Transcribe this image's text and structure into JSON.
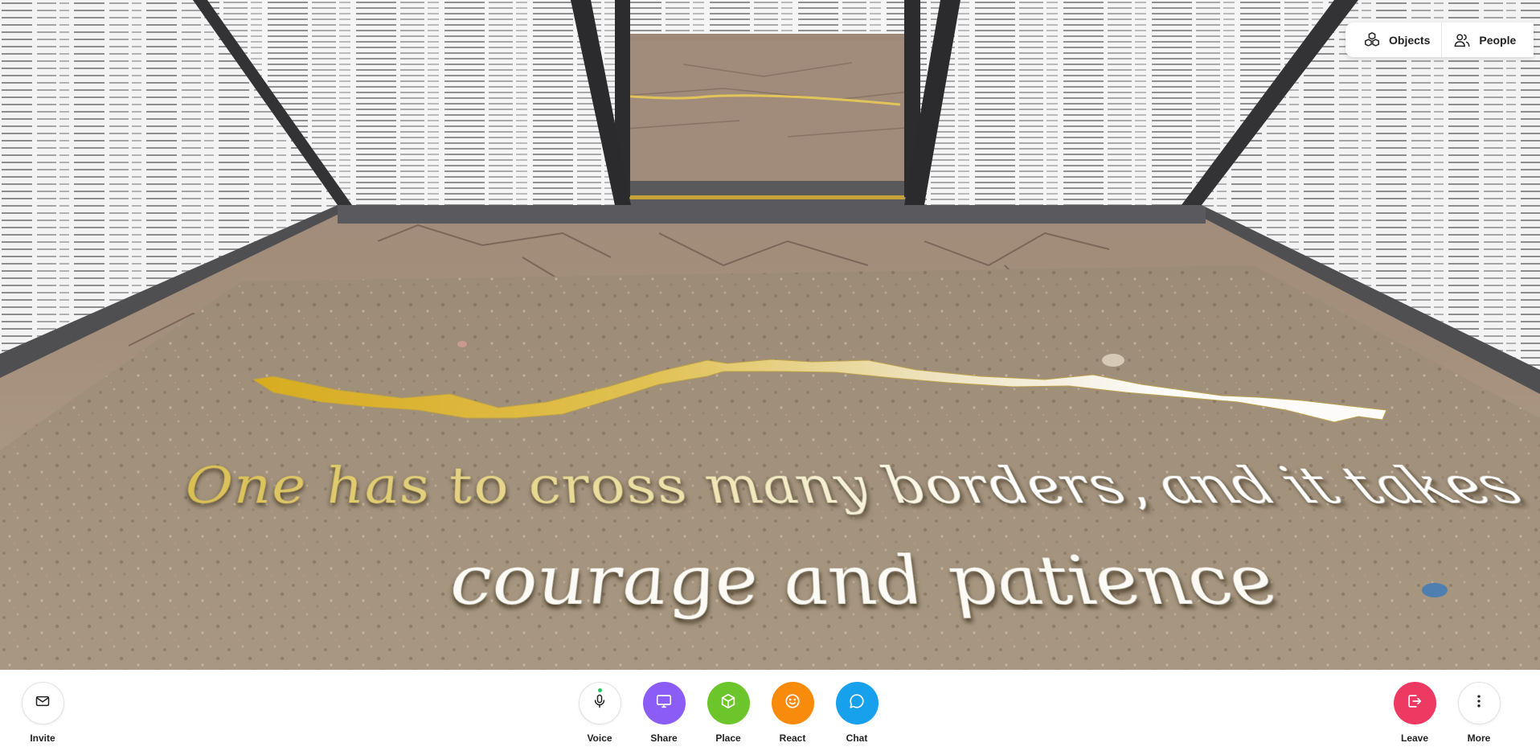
{
  "scene": {
    "floor_text": {
      "line1": "One has to cross many borders, and it takes",
      "line2": "courage and patience"
    }
  },
  "top_tabs": {
    "objects_label": "Objects",
    "people_label": "People"
  },
  "toolbar": {
    "invite_label": "Invite",
    "voice_label": "Voice",
    "share_label": "Share",
    "place_label": "Place",
    "react_label": "React",
    "chat_label": "Chat",
    "leave_label": "Leave",
    "more_label": "More"
  },
  "colors": {
    "share": "#8b5cf6",
    "place": "#6cc52b",
    "react": "#f98b0c",
    "chat": "#17a0eb",
    "leave": "#ee3a62",
    "mic_status": "#22c55e"
  },
  "icons": {
    "invite": "envelope-icon",
    "voice": "microphone-icon",
    "share": "monitor-icon",
    "place": "cube-icon",
    "react": "smiley-icon",
    "chat": "speech-bubble-icon",
    "leave": "exit-icon",
    "more": "vertical-dots-icon",
    "objects": "stacked-cubes-icon",
    "people": "people-icon"
  }
}
